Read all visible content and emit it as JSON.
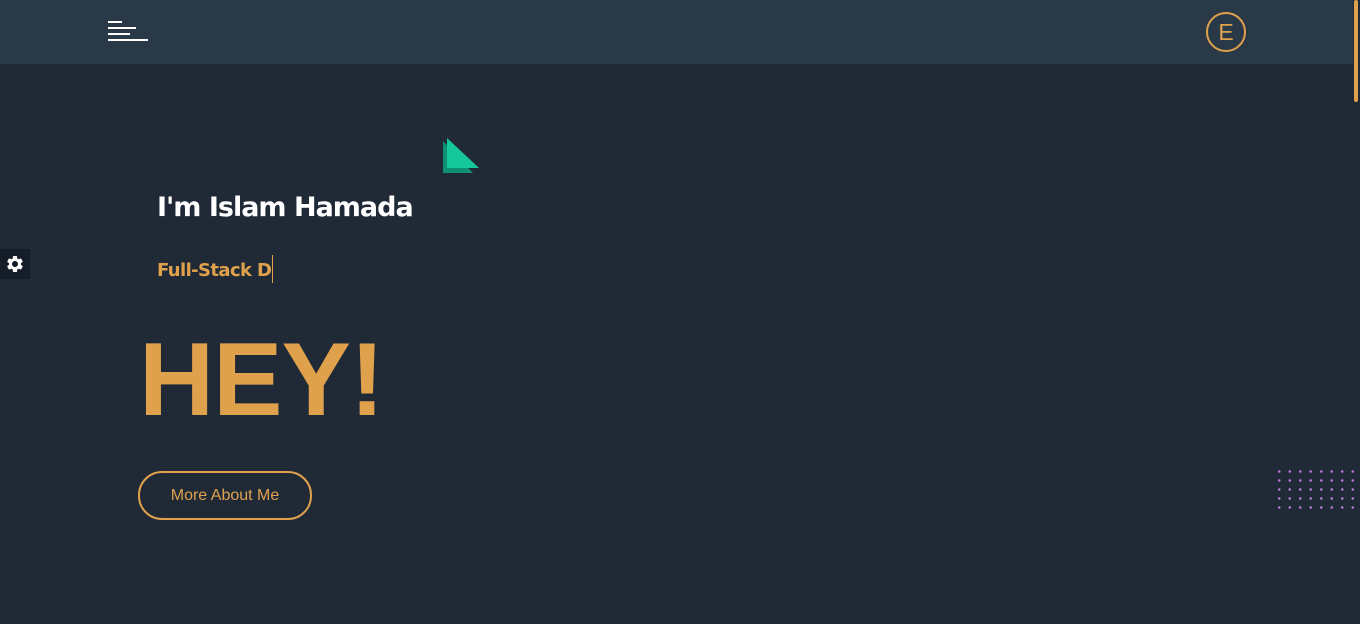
{
  "header": {
    "menu_icon": "hamburger-menu-icon",
    "logo_letter": "E"
  },
  "hero": {
    "intro": "I'm Islam Hamada",
    "role_typed": "Full-Stack D",
    "greeting": "HEY!",
    "cta_label": "More About Me"
  },
  "widgets": {
    "settings_icon": "gear-icon",
    "decoration_icon": "green-triangle-icon",
    "dots_pattern": "dot-grid-pattern"
  },
  "colors": {
    "background": "#202a37",
    "navbar": "#2a3947",
    "accent": "#e0a14d",
    "text_light": "#ffffff",
    "triangle": "#12c39a",
    "dots": "#b977d4"
  }
}
